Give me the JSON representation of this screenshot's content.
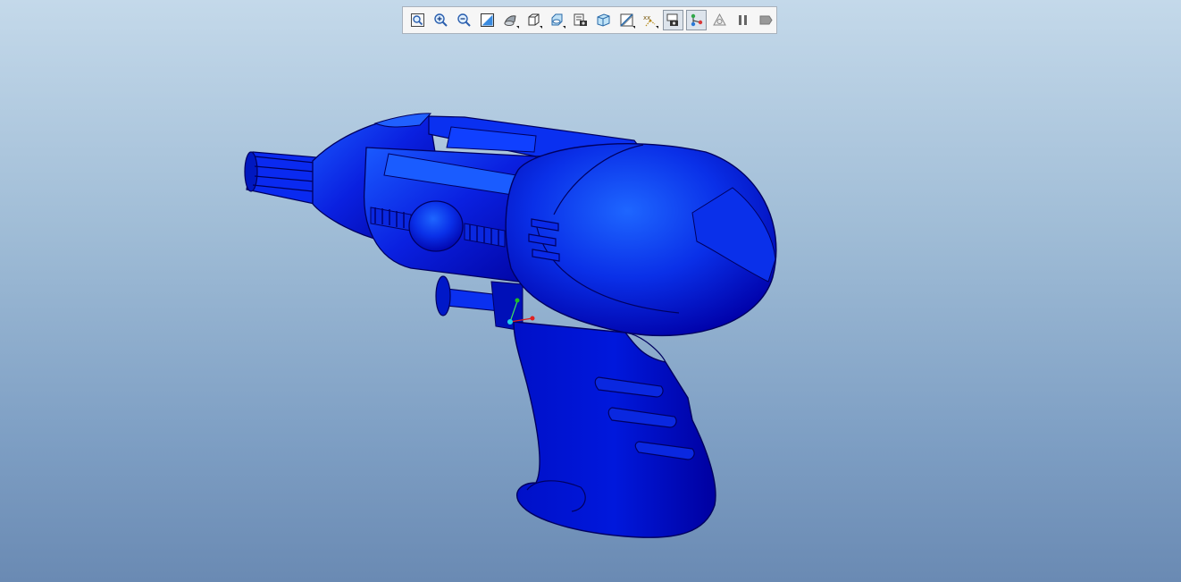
{
  "viewer": {
    "background_top": "#c4d9ea",
    "background_bottom": "#6a8ab3",
    "model_color": "#0000cc",
    "model_highlight": "#1a55ff"
  },
  "toolbar": {
    "buttons": [
      {
        "name": "zoom-fit-button",
        "icon": "zoom-fit-icon",
        "active": false
      },
      {
        "name": "zoom-in-button",
        "icon": "zoom-in-icon",
        "active": false
      },
      {
        "name": "zoom-out-button",
        "icon": "zoom-out-icon",
        "active": false
      },
      {
        "name": "repaint-button",
        "icon": "repaint-icon",
        "active": false
      },
      {
        "name": "display-style-button",
        "icon": "display-style-icon",
        "active": false,
        "dropdown": true
      },
      {
        "name": "saved-orientations-button",
        "icon": "cube-view-icon",
        "active": false,
        "dropdown": true
      },
      {
        "name": "named-views-button",
        "icon": "named-view-icon",
        "active": false,
        "dropdown": true
      },
      {
        "name": "view-manager-button",
        "icon": "view-manager-icon",
        "active": false
      },
      {
        "name": "perspective-view-button",
        "icon": "perspective-icon",
        "active": false
      },
      {
        "name": "section-button",
        "icon": "section-icon",
        "active": false,
        "dropdown": true
      },
      {
        "name": "datum-display-button",
        "icon": "datum-display-icon",
        "active": false,
        "dropdown": true
      },
      {
        "name": "annotation-display-button",
        "icon": "annotation-display-icon",
        "active": true
      },
      {
        "name": "spin-center-button",
        "icon": "spin-center-icon",
        "active": true
      },
      {
        "name": "regenerate-button",
        "icon": "regenerate-icon",
        "active": false
      },
      {
        "name": "pause-button",
        "icon": "pause-icon",
        "active": false
      },
      {
        "name": "next-button",
        "icon": "next-icon",
        "active": false
      }
    ]
  },
  "axes": {
    "x_color": "#e02020",
    "y_color": "#20c020",
    "z_color": "#20c0e0"
  }
}
